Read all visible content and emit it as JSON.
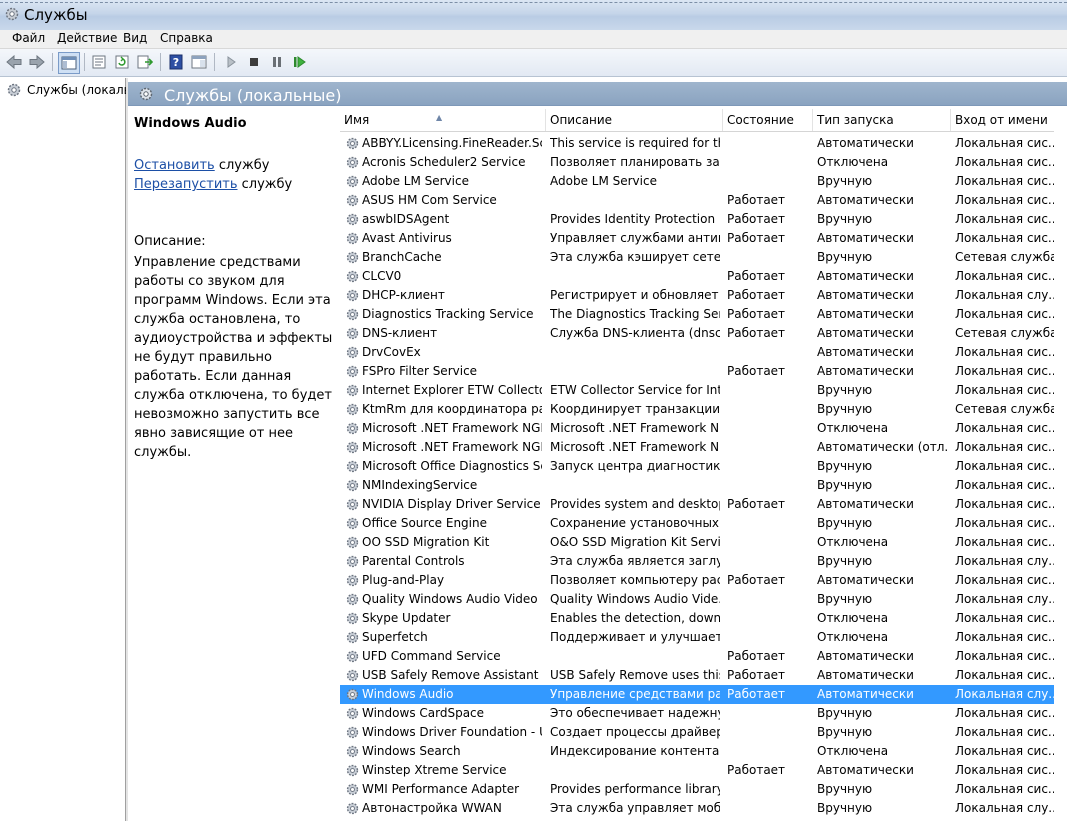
{
  "window": {
    "title": "Службы"
  },
  "menu": [
    "Файл",
    "Действие",
    "Вид",
    "Справка"
  ],
  "toolbar": {
    "icons": [
      "back-icon",
      "forward-icon",
      "show-hide-tree-icon",
      "properties-icon",
      "refresh-icon",
      "export-list-icon",
      "help-icon",
      "toggle-view-icon",
      "start-service-icon",
      "stop-service-icon",
      "pause-service-icon",
      "restart-service-icon"
    ]
  },
  "tree": {
    "root_label": "Службы (локалы"
  },
  "panel": {
    "title": "Службы (локальные)"
  },
  "details": {
    "service_name": "Windows Audio",
    "stop_link": "Остановить",
    "stop_suffix": " службу",
    "restart_link": "Перезапустить",
    "restart_suffix": " службу",
    "description_label": "Описание:",
    "description_text": "Управление средствами работы со звуком для программ Windows.  Если эта служба остановлена, то аудиоустройства и эффекты не будут правильно работать. Если данная служба отключена, то будет невозможно запустить все явно зависящие от нее службы."
  },
  "columns": [
    "Имя",
    "Описание",
    "Состояние",
    "Тип запуска",
    "Вход от имени"
  ],
  "colors": {
    "selection": "#3399ff",
    "header_bg": "#8aa3c0",
    "link": "#1c4fa6"
  },
  "services": [
    {
      "name": "ABBYY.Licensing.FineReader.Scr...",
      "desc": "This service is required for th...",
      "status": "",
      "startup": "Автоматически",
      "logon": "Локальная сис..."
    },
    {
      "name": "Acronis Scheduler2 Service",
      "desc": "Позволяет планировать зад...",
      "status": "",
      "startup": "Отключена",
      "logon": "Локальная сис..."
    },
    {
      "name": "Adobe LM Service",
      "desc": "Adobe LM Service",
      "status": "",
      "startup": "Вручную",
      "logon": "Локальная сис..."
    },
    {
      "name": "ASUS HM Com Service",
      "desc": "",
      "status": "Работает",
      "startup": "Автоматически",
      "logon": "Локальная сис..."
    },
    {
      "name": "aswbIDSAgent",
      "desc": "Provides Identity Protection ...",
      "status": "Работает",
      "startup": "Вручную",
      "logon": "Локальная сис..."
    },
    {
      "name": "Avast Antivirus",
      "desc": "Управляет службами антив...",
      "status": "Работает",
      "startup": "Автоматически",
      "logon": "Локальная сис..."
    },
    {
      "name": "BranchCache",
      "desc": "Эта служба кэширует сетев...",
      "status": "",
      "startup": "Вручную",
      "logon": "Сетевая служба"
    },
    {
      "name": "CLCV0",
      "desc": "",
      "status": "Работает",
      "startup": "Автоматически",
      "logon": "Локальная сис..."
    },
    {
      "name": "DHCP-клиент",
      "desc": "Регистрирует и обновляет I...",
      "status": "Работает",
      "startup": "Автоматически",
      "logon": "Локальная слу..."
    },
    {
      "name": "Diagnostics Tracking Service",
      "desc": "The Diagnostics Tracking Ser...",
      "status": "Работает",
      "startup": "Автоматически",
      "logon": "Локальная сис..."
    },
    {
      "name": "DNS-клиент",
      "desc": "Служба DNS-клиента (dnsca...",
      "status": "Работает",
      "startup": "Автоматически",
      "logon": "Сетевая служба"
    },
    {
      "name": "DrvCovEx",
      "desc": "",
      "status": "",
      "startup": "Автоматически",
      "logon": "Локальная сис..."
    },
    {
      "name": "FSPro Filter Service",
      "desc": "",
      "status": "Работает",
      "startup": "Автоматически",
      "logon": "Локальная сис..."
    },
    {
      "name": "Internet Explorer ETW Collector ...",
      "desc": "ETW Collector Service for Inte...",
      "status": "",
      "startup": "Вручную",
      "logon": "Локальная сис..."
    },
    {
      "name": "KtmRm для координатора рас...",
      "desc": "Координирует транзакции ...",
      "status": "",
      "startup": "Вручную",
      "logon": "Сетевая служба"
    },
    {
      "name": "Microsoft .NET Framework NGE...",
      "desc": "Microsoft .NET Framework N...",
      "status": "",
      "startup": "Отключена",
      "logon": "Локальная сис..."
    },
    {
      "name": "Microsoft .NET Framework NGE...",
      "desc": "Microsoft .NET Framework N...",
      "status": "",
      "startup": "Автоматически (отл...",
      "logon": "Локальная сис..."
    },
    {
      "name": "Microsoft Office Diagnostics Ser...",
      "desc": "Запуск центра диагностики ...",
      "status": "",
      "startup": "Вручную",
      "logon": "Локальная сис..."
    },
    {
      "name": "NMIndexingService",
      "desc": "",
      "status": "",
      "startup": "Вручную",
      "logon": "Локальная сис..."
    },
    {
      "name": "NVIDIA Display Driver Service",
      "desc": "Provides system and desktop ...",
      "status": "Работает",
      "startup": "Автоматически",
      "logon": "Локальная сис..."
    },
    {
      "name": "Office Source Engine",
      "desc": "Сохранение установочных ...",
      "status": "",
      "startup": "Вручную",
      "logon": "Локальная сис..."
    },
    {
      "name": "OO SSD Migration Kit",
      "desc": "O&O SSD Migration Kit Service",
      "status": "",
      "startup": "Отключена",
      "logon": "Локальная сис..."
    },
    {
      "name": "Parental Controls",
      "desc": "Эта служба является заглуш...",
      "status": "",
      "startup": "Вручную",
      "logon": "Локальная слу..."
    },
    {
      "name": "Plug-and-Play",
      "desc": "Позволяет компьютеру рас...",
      "status": "Работает",
      "startup": "Автоматически",
      "logon": "Локальная сис..."
    },
    {
      "name": "Quality Windows Audio Video E...",
      "desc": "Quality Windows Audio Vide...",
      "status": "",
      "startup": "Вручную",
      "logon": "Локальная слу..."
    },
    {
      "name": "Skype Updater",
      "desc": "Enables the detection, downl...",
      "status": "",
      "startup": "Отключена",
      "logon": "Локальная сис..."
    },
    {
      "name": "Superfetch",
      "desc": "Поддерживает и улучшает ...",
      "status": "",
      "startup": "Отключена",
      "logon": "Локальная сис..."
    },
    {
      "name": "UFD Command Service",
      "desc": "",
      "status": "Работает",
      "startup": "Автоматически",
      "logon": "Локальная сис..."
    },
    {
      "name": "USB Safely Remove Assistant",
      "desc": "USB Safely Remove uses this ...",
      "status": "Работает",
      "startup": "Автоматически",
      "logon": "Локальная сис..."
    },
    {
      "name": "Windows Audio",
      "desc": "Управление средствами раб...",
      "status": "Работает",
      "startup": "Автоматически",
      "logon": "Локальная слу...",
      "selected": true
    },
    {
      "name": "Windows CardSpace",
      "desc": "Это обеспечивает надежну...",
      "status": "",
      "startup": "Вручную",
      "logon": "Локальная сис..."
    },
    {
      "name": "Windows Driver Foundation - U...",
      "desc": "Создает процессы драйверо...",
      "status": "",
      "startup": "Вручную",
      "logon": "Локальная сис..."
    },
    {
      "name": "Windows Search",
      "desc": "Индексирование контента, ...",
      "status": "",
      "startup": "Отключена",
      "logon": "Локальная сис..."
    },
    {
      "name": "Winstep Xtreme Service",
      "desc": "",
      "status": "Работает",
      "startup": "Автоматически",
      "logon": "Локальная сис..."
    },
    {
      "name": "WMI Performance Adapter",
      "desc": "Provides performance library ...",
      "status": "",
      "startup": "Вручную",
      "logon": "Локальная сис..."
    },
    {
      "name": "Автонастройка WWAN",
      "desc": "Эта служба управляет моби...",
      "status": "",
      "startup": "Вручную",
      "logon": "Локальная слу..."
    }
  ]
}
